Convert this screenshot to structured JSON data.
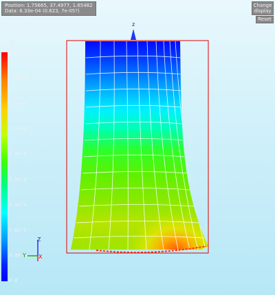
{
  "app": {
    "info_line_1": "Position: 1.75665, 37.4977, 1.65482",
    "info_line_2": "Data: 6.33e-04 (0.623, 7e-05?)",
    "right_label_1": "Change",
    "right_label_2": "display",
    "right_button": "Reset"
  },
  "scale": {
    "top_marker": "--",
    "labels": [
      "3.3e-4",
      "3.0e-4",
      "2.6e-4",
      "2.2e-4",
      "1.9e-4",
      "1.5e-4",
      "1.1e-4",
      "7.6e-5",
      "3.8e-5",
      "0.0"
    ]
  },
  "axes": {
    "top_axis_label": "z",
    "mini_z": "Z",
    "mini_y": "Y",
    "mini_x": "X"
  },
  "colors": {
    "frame": "#e00000",
    "mesh": "#ffffff"
  }
}
